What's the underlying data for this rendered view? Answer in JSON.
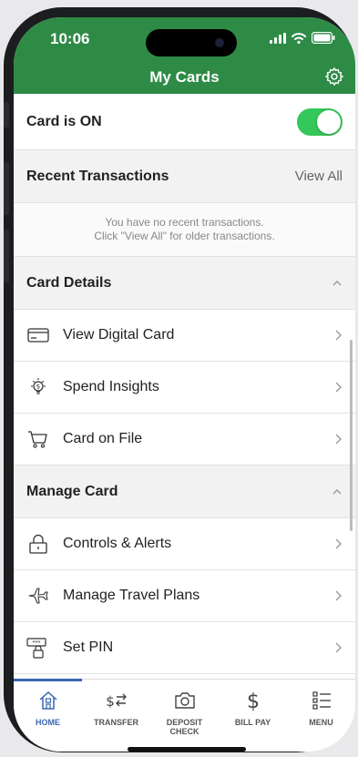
{
  "status_bar": {
    "time": "10:06"
  },
  "header": {
    "title": "My Cards"
  },
  "card_status": {
    "label": "Card is ON",
    "enabled": true
  },
  "recent": {
    "label": "Recent Transactions",
    "view_all": "View All",
    "empty_line1": "You have no recent transactions.",
    "empty_line2": "Click \"View All\" for older transactions."
  },
  "card_details": {
    "label": "Card Details",
    "items": [
      {
        "label": "View Digital Card",
        "icon": "credit-card-icon"
      },
      {
        "label": "Spend Insights",
        "icon": "lightbulb-dollar-icon"
      },
      {
        "label": "Card on File",
        "icon": "cart-icon"
      }
    ]
  },
  "manage_card": {
    "label": "Manage Card",
    "items": [
      {
        "label": "Controls & Alerts",
        "icon": "lock-icon"
      },
      {
        "label": "Manage Travel Plans",
        "icon": "airplane-icon"
      },
      {
        "label": "Set PIN",
        "icon": "pin-icon"
      }
    ]
  },
  "tabbar": {
    "tabs": [
      {
        "label": "HOME",
        "icon": "home-icon",
        "active": true
      },
      {
        "label": "TRANSFER",
        "icon": "transfer-icon"
      },
      {
        "label": "DEPOSIT\nCHECK",
        "icon": "camera-icon"
      },
      {
        "label": "BILL PAY",
        "icon": "dollar-icon"
      },
      {
        "label": "MENU",
        "icon": "menu-icon"
      }
    ]
  },
  "colors": {
    "brand_green": "#2e8b46",
    "toggle_on": "#34c759",
    "active_tab": "#3a66b0"
  }
}
